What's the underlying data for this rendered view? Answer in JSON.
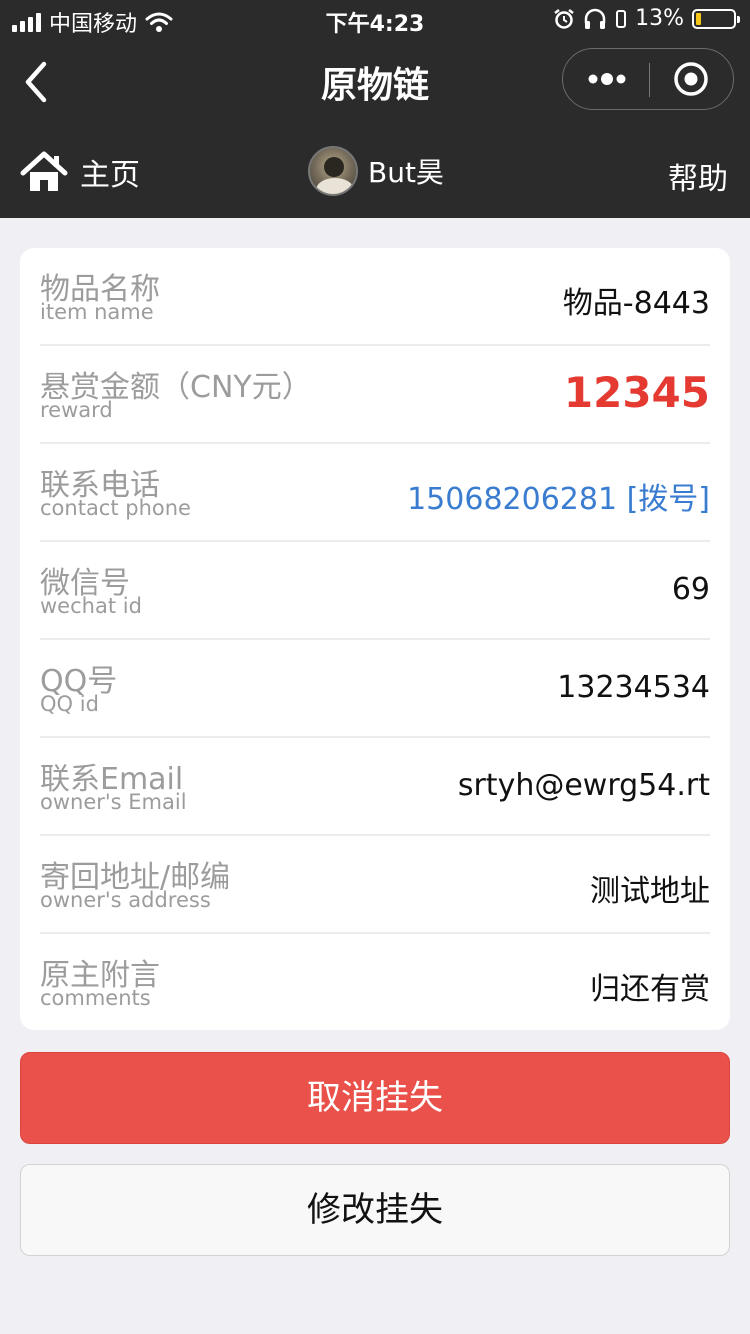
{
  "status_bar": {
    "carrier": "中国移动",
    "time": "下午4:23",
    "battery": "13%",
    "battery_level": 0.13
  },
  "nav": {
    "title": "原物链"
  },
  "subnav": {
    "home_label": "主页",
    "username": "But昊",
    "help_label": "帮助"
  },
  "details": [
    {
      "label_cn": "物品名称",
      "label_en": "item name",
      "value": "物品-8443"
    },
    {
      "label_cn": "悬赏金额（CNY元）",
      "label_en": "reward",
      "value": "12345"
    },
    {
      "label_cn": "联系电话",
      "label_en": "contact phone",
      "value": "15068206281 [拨号]"
    },
    {
      "label_cn": "微信号",
      "label_en": "wechat id",
      "value": "69"
    },
    {
      "label_cn": "QQ号",
      "label_en": "QQ id",
      "value": "13234534"
    },
    {
      "label_cn": "联系Email",
      "label_en": "owner's Email",
      "value": "srtyh@ewrg54.rt"
    },
    {
      "label_cn": "寄回地址/邮编",
      "label_en": "owner's address",
      "value": "测试地址"
    },
    {
      "label_cn": "原主附言",
      "label_en": "comments",
      "value": "归还有赏"
    }
  ],
  "actions": {
    "cancel_label": "取消挂失",
    "edit_label": "修改挂失"
  },
  "colors": {
    "header_bg": "#2b2b2b",
    "reward": "#e53a32",
    "link": "#3a7dd0",
    "primary_button": "#e9514a"
  }
}
